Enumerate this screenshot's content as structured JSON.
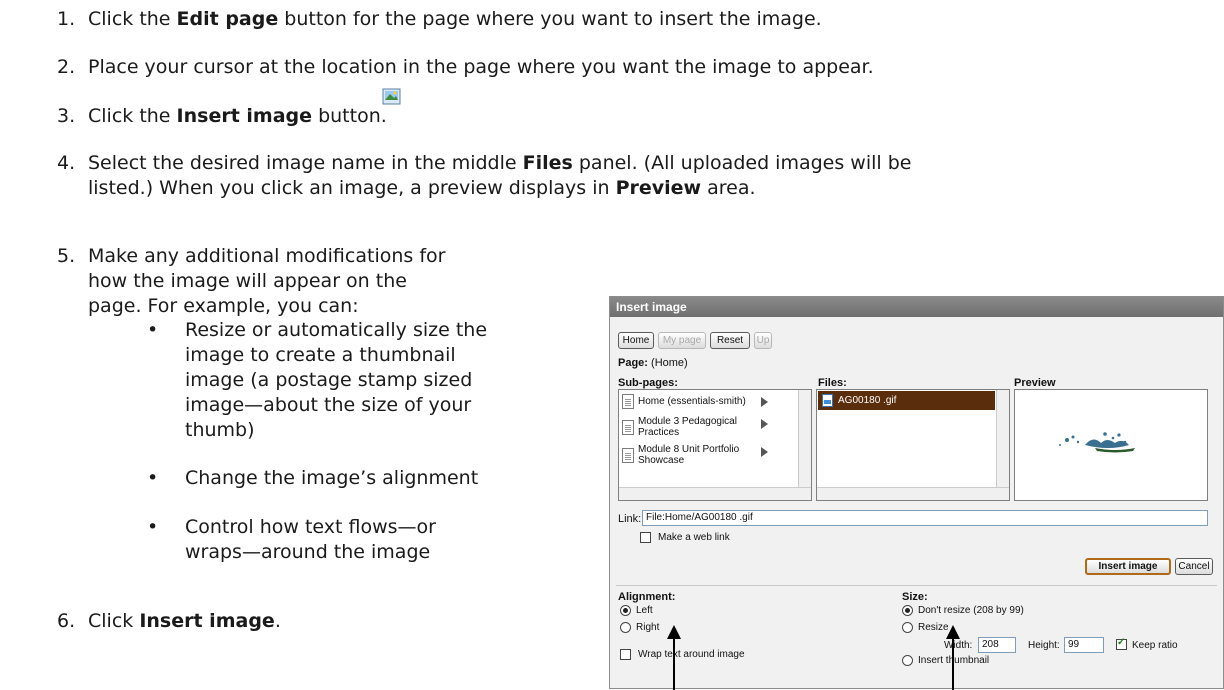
{
  "steps": [
    {
      "num": "1.",
      "pre": "Click the ",
      "bold": "Edit page",
      "post": " button for the page where you want to insert the image."
    },
    {
      "num": "2.",
      "text": "Place your cursor at the location in the page where you want the image to appear."
    },
    {
      "num": "3.",
      "pre": "Click the ",
      "bold": "Insert image",
      "post": " button."
    },
    {
      "num": "4.",
      "pre": "Select the desired image name in the middle ",
      "bold": "Files",
      "post": " panel. (All uploaded images will be",
      "line2_pre": "listed.) When you click an image, a preview displays in ",
      "line2_bold": "Preview",
      "line2_post": " area."
    },
    {
      "num": "5.",
      "lines": [
        "Make any additional modifications for",
        "how the image will appear on the",
        "page. For example, you can:"
      ]
    },
    {
      "num": "6.",
      "pre": "Click ",
      "bold": "Insert image",
      "post": "."
    }
  ],
  "bullets": [
    {
      "lines": [
        "Resize or automatically size the",
        "image to create a thumbnail",
        "image (a postage stamp sized",
        "image—about the size of your",
        "thumb)"
      ]
    },
    {
      "lines": [
        "Change the image’s alignment"
      ]
    },
    {
      "lines": [
        "Control how text flows—or",
        "wraps—around the image"
      ]
    }
  ],
  "dialog": {
    "title": "Insert image",
    "nav_buttons": {
      "home": "Home",
      "my_page": "My page",
      "reset": "Reset",
      "up": "Up"
    },
    "page_label": "Page:",
    "page_value": "(Home)",
    "subpages_header": "Sub-pages:",
    "subpages": [
      {
        "label": [
          "Home (essentials-smith)"
        ]
      },
      {
        "label": [
          "Module 3 Pedagogical",
          "Practices"
        ]
      },
      {
        "label": [
          "Module 8 Unit Portfolio",
          "Showcase"
        ]
      }
    ],
    "files_header": "Files:",
    "files": [
      "AG00180 .gif"
    ],
    "preview_header": "Preview",
    "link_label": "Link:",
    "link_value": "File:Home/AG00180 .gif",
    "web_link_label": "Make a web link",
    "insert_button": "Insert image",
    "cancel_button": "Cancel",
    "alignment_header": "Alignment:",
    "align_left": "Left",
    "align_right": "Right",
    "wrap_label": "Wrap text around image",
    "size_header": "Size:",
    "dont_resize": "Don't resize  (208 by 99)",
    "resize": "Resize",
    "width_label": "Width:",
    "width_value": "208",
    "height_label": "Height:",
    "height_value": "99",
    "keep_ratio": "Keep ratio",
    "insert_thumbnail": "Insert thumbnail"
  }
}
